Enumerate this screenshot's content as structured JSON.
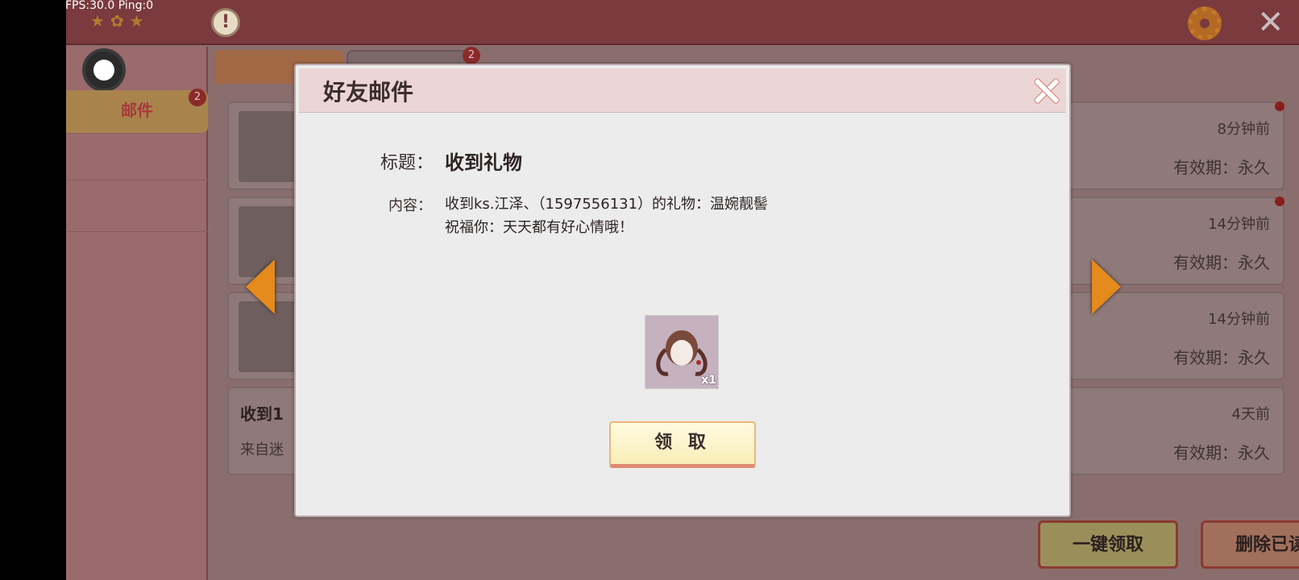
{
  "overlay": {
    "fps_text": "FPS:30.0  Ping:0"
  },
  "sidebar": {
    "items": [
      {
        "label": "邮件",
        "badge": "2"
      }
    ]
  },
  "tabs": {
    "friend_badge": "2"
  },
  "mails": [
    {
      "time": "8分钟前",
      "expire": "有效期：永久"
    },
    {
      "time": "14分钟前",
      "expire": "有效期：永久"
    },
    {
      "time": "14分钟前",
      "expire": "有效期：永久"
    },
    {
      "time": "4天前",
      "expire": "有效期：永久",
      "title": "收到1",
      "from": "来自迷"
    }
  ],
  "actions": {
    "claim_all": "一键领取",
    "delete_read": "删除已读"
  },
  "dialog": {
    "title": "好友邮件",
    "subject_label": "标题：",
    "subject": "收到礼物",
    "content_label": "内容：",
    "content_line1": "收到ks.江泽、（1597556131）的礼物：温婉靓髻",
    "content_line2": "祝福你：天天都有好心情哦！",
    "gift_qty": "x1",
    "claim_button": "领 取"
  },
  "icons": [
    "alert-icon",
    "gear-icon",
    "close-icon",
    "arrow-left-icon",
    "arrow-right-icon"
  ]
}
